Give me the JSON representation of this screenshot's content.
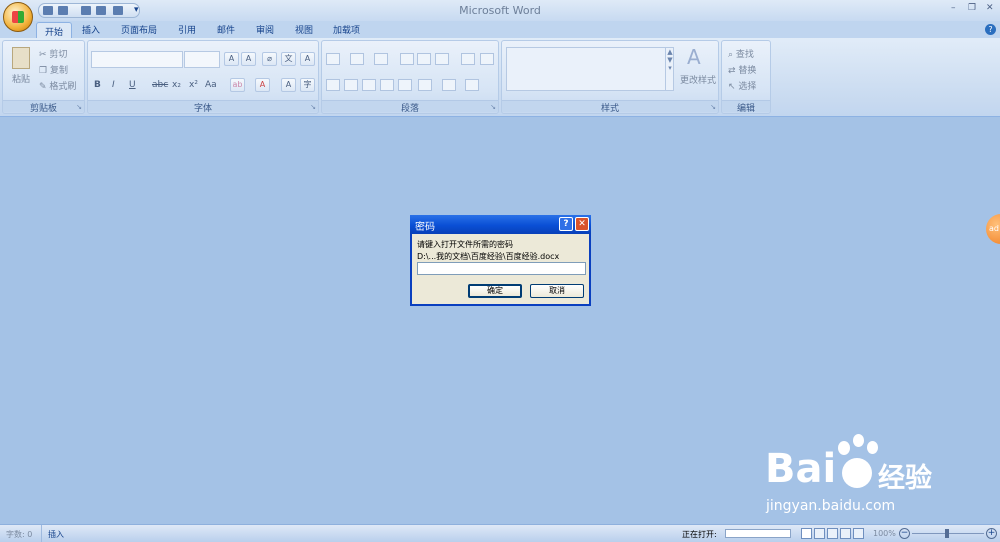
{
  "app": {
    "window_title": "Microsoft Word"
  },
  "tabs": [
    "开始",
    "插入",
    "页面布局",
    "引用",
    "邮件",
    "审阅",
    "视图",
    "加载项"
  ],
  "clipboard": {
    "paste": "粘贴",
    "cut": "剪切",
    "copy": "复制",
    "format_painter": "格式刷",
    "label": "剪贴板"
  },
  "groups": {
    "font": "字体",
    "paragraph": "段落",
    "styles": "样式",
    "editing": "编辑"
  },
  "font_buttons": {
    "bold": "B",
    "italic": "I",
    "underline": "U",
    "strike": "abc",
    "subscript": "x₂",
    "superscript": "x²",
    "change_case": "Aa"
  },
  "styles": {
    "change_styles": "更改样式"
  },
  "editing": {
    "find": "查找",
    "replace": "替换",
    "select": "选择"
  },
  "dialog": {
    "title": "密码",
    "prompt": "请键入打开文件所需的密码",
    "path": "D:\\...我的文档\\百度经验\\百度经验.docx",
    "password_value": "",
    "ok": "确定",
    "cancel": "取消"
  },
  "status": {
    "word_count": "字数: 0",
    "insert_mode": "插入",
    "opening": "正在打开:",
    "zoom": "100%"
  },
  "watermark": {
    "brand": "Bai",
    "brand_cn": "经验",
    "url": "jingyan.baidu.com"
  },
  "float_badge": "ad",
  "colors": {
    "background": "#a4c2e6",
    "ribbon": "#dce8f6",
    "dialog_title": "#0a4fd5",
    "close": "#d9532b"
  }
}
